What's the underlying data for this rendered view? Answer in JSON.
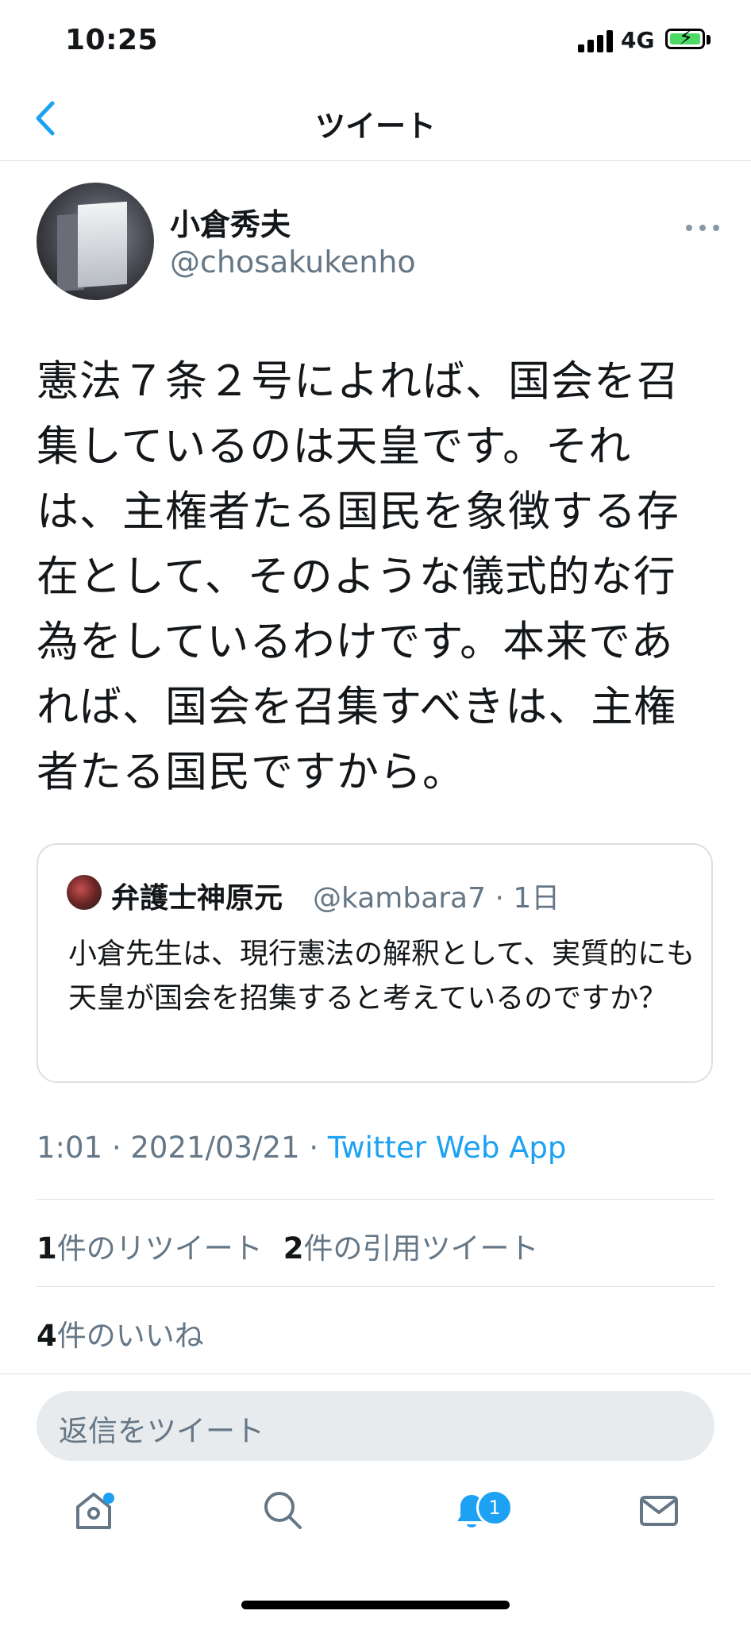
{
  "status_bar": {
    "time": "10:25",
    "network": "4G",
    "icons": [
      "signal-icon",
      "battery-charging-icon"
    ]
  },
  "nav": {
    "title": "ツイート",
    "back_icon": "chevron-left-icon"
  },
  "tweet": {
    "author": {
      "display_name": "小倉秀夫",
      "handle": "@chosakukenho"
    },
    "more_icon": "more-horizontal-icon",
    "text": "憲法７条２号によれば、国会を召集しているのは天皇です。それは、主権者たる国民を象徴する存在として、そのような儀式的な行為をしているわけです。本来であれば、国会を召集すべきは、主権者たる国民ですから。",
    "quoted": {
      "display_name": "弁護士神原元",
      "handle_time": "@kambara7 · 1日",
      "text": "小倉先生は、現行憲法の解釈として、実質的にも天皇が国会を招集すると考えているのですか？"
    },
    "time_date": "1:01 · 2021/03/21 · ",
    "source": "Twitter Web App",
    "stats": {
      "retweets_count": "1",
      "retweets_label": "件のリツイート",
      "quotes_count": "2",
      "quotes_label": "件の引用ツイート",
      "likes_count": "4",
      "likes_label": "件のいいね"
    }
  },
  "reply": {
    "placeholder": "返信をツイート"
  },
  "tab_bar": {
    "items": [
      {
        "name": "home",
        "icon": "home-icon"
      },
      {
        "name": "search",
        "icon": "search-icon"
      },
      {
        "name": "notifications",
        "icon": "bell-icon",
        "badge": "1"
      },
      {
        "name": "messages",
        "icon": "mail-icon"
      }
    ]
  },
  "colors": {
    "accent": "#1da1f2",
    "secondary_text": "#657786",
    "primary_text": "#14171a",
    "divider": "#dcdfe3"
  }
}
